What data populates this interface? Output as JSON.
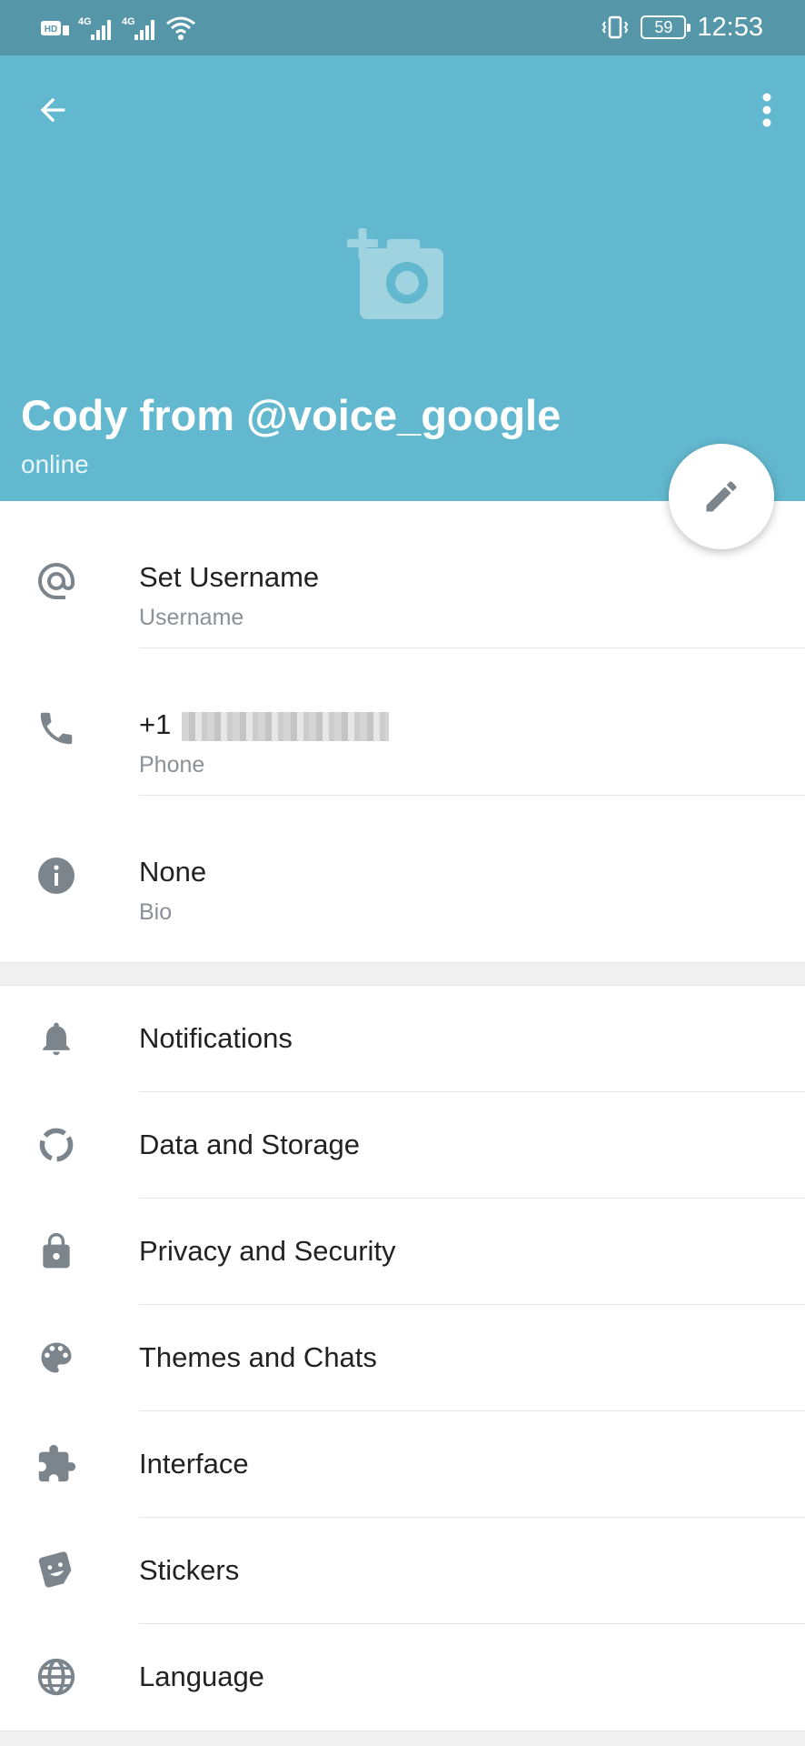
{
  "status_bar": {
    "time": "12:53",
    "battery": "59",
    "network_1": "4G",
    "network_2": "4G",
    "hd_label": "HD"
  },
  "colors": {
    "header": "#62b8ce",
    "status_bar": "#5597a9",
    "icon_gray": "#7d858c"
  },
  "header": {
    "name": "Cody from @voice_google",
    "status": "online",
    "icons": [
      "back-arrow-icon",
      "more-vert-icon",
      "add-photo-icon",
      "edit-pencil-icon"
    ]
  },
  "info": [
    {
      "icon": "at-sign-icon",
      "value": "Set Username",
      "label": "Username"
    },
    {
      "icon": "phone-icon",
      "value": "+1",
      "label": "Phone",
      "redacted": true
    },
    {
      "icon": "info-icon",
      "value": "None",
      "label": "Bio"
    }
  ],
  "settings": [
    {
      "icon": "bell-icon",
      "label": "Notifications"
    },
    {
      "icon": "data-storage-icon",
      "label": "Data and Storage"
    },
    {
      "icon": "lock-icon",
      "label": "Privacy and Security"
    },
    {
      "icon": "palette-icon",
      "label": "Themes and Chats"
    },
    {
      "icon": "puzzle-icon",
      "label": "Interface"
    },
    {
      "icon": "sticker-icon",
      "label": "Stickers"
    },
    {
      "icon": "globe-icon",
      "label": "Language"
    }
  ]
}
